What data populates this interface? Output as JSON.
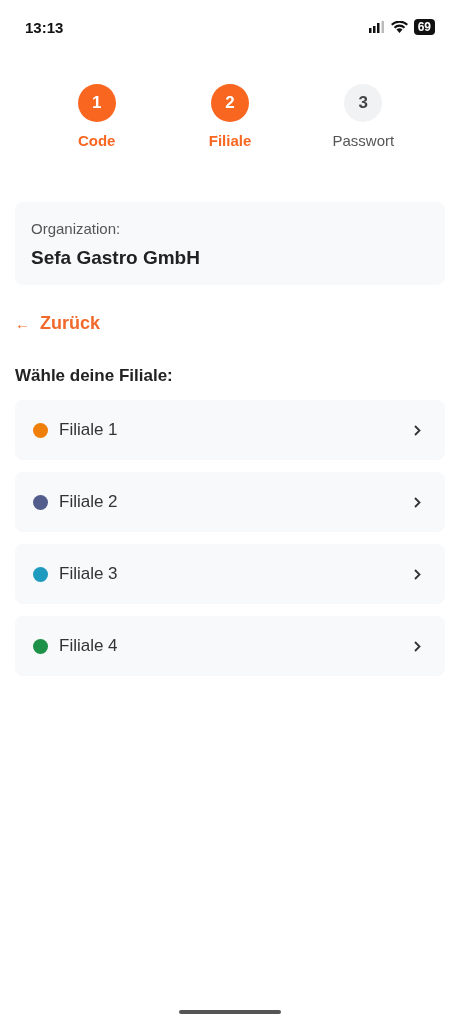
{
  "status_bar": {
    "time": "13:13",
    "battery": "69"
  },
  "steps": [
    {
      "number": "1",
      "label": "Code",
      "reached": true
    },
    {
      "number": "2",
      "label": "Filiale",
      "reached": true
    },
    {
      "number": "3",
      "label": "Passwort",
      "reached": false
    }
  ],
  "organization": {
    "label": "Organization:",
    "name": "Sefa Gastro GmbH"
  },
  "back_link": {
    "icon": "←",
    "label": "Zurück"
  },
  "heading": "Wähle deine Filiale:",
  "branches": [
    {
      "name": "Filiale 1",
      "color": "#f07f0a"
    },
    {
      "name": "Filiale 2",
      "color": "#525d8c"
    },
    {
      "name": "Filiale 3",
      "color": "#1f9bbf"
    },
    {
      "name": "Filiale 4",
      "color": "#1e9148"
    }
  ]
}
